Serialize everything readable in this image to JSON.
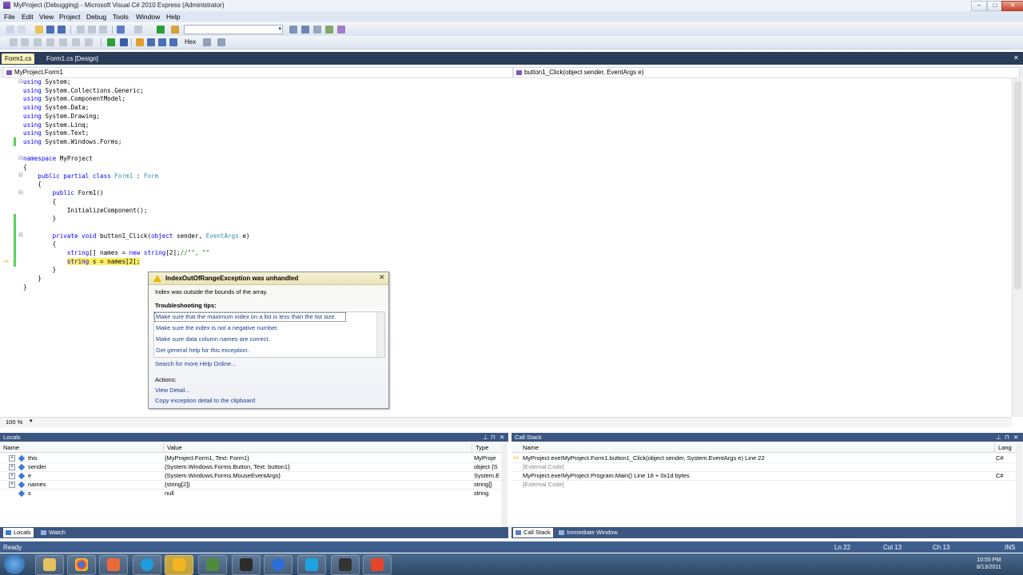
{
  "window": {
    "title": "MyProject (Debugging) - Microsoft Visual C# 2010 Express (Administrator)",
    "min": "–",
    "max": "□",
    "close": "✕"
  },
  "menu": [
    "File",
    "Edit",
    "View",
    "Project",
    "Debug",
    "Tools",
    "Window",
    "Help"
  ],
  "toolbar": {
    "hex_label": "Hex",
    "combo_value": ""
  },
  "doc_tabs": [
    "Form1.cs",
    "Form1.cs [Design]"
  ],
  "nav": {
    "class_combo": "MyProject.Form1",
    "member_combo": "button1_Click(object sender, EventArgs e)"
  },
  "code": [
    "using System;",
    "using System.Collections.Generic;",
    "using System.ComponentModel;",
    "using System.Data;",
    "using System.Drawing;",
    "using System.Linq;",
    "using System.Text;",
    "using System.Windows.Forms;",
    "",
    "namespace MyProject",
    "{",
    "    public partial class Form1 : Form",
    "    {",
    "        public Form1()",
    "        {",
    "            InitializeComponent();",
    "        }",
    "",
    "        private void button1_Click(object sender, EventArgs e)",
    "        {",
    "            string[] names = new string[2];//\"\", \"\"",
    "            string s = names[2];",
    "        }",
    "    }",
    "}"
  ],
  "zoom": "100 %",
  "exception": {
    "title": "IndexOutOfRangeException was unhandled",
    "message": "Index was outside the bounds of the array.",
    "tips_heading": "Troubleshooting tips:",
    "tips": [
      "Make sure that the maximum index on a list is less than the list size.",
      "Make sure the index is not a negative number.",
      "Make sure data column names are correct.",
      "Get general help for this exception."
    ],
    "search_link": "Search for more Help Online...",
    "actions_heading": "Actions:",
    "actions": [
      "View Detail...",
      "Copy exception detail to the clipboard"
    ],
    "close": "✕"
  },
  "locals": {
    "title": "Locals",
    "columns": [
      "Name",
      "Value",
      "Type"
    ],
    "rows": [
      {
        "name": "this",
        "value": "{MyProject.Form1, Text: Form1}",
        "type": "MyProje",
        "expandable": true
      },
      {
        "name": "sender",
        "value": "{System.Windows.Forms.Button, Text: button1}",
        "type": "object {S",
        "expandable": true
      },
      {
        "name": "e",
        "value": "{System.Windows.Forms.MouseEventArgs}",
        "type": "System.E",
        "expandable": true
      },
      {
        "name": "names",
        "value": "{string[2]}",
        "type": "string[]",
        "expandable": true
      },
      {
        "name": "s",
        "value": "null",
        "type": "string",
        "expandable": false
      }
    ],
    "tabs": [
      "Locals",
      "Watch"
    ]
  },
  "callstack": {
    "title": "Call Stack",
    "columns": [
      "Name",
      "Lang"
    ],
    "rows": [
      {
        "name": "MyProject.exe!MyProject.Form1.button1_Click(object sender, System.EventArgs e) Line 22",
        "lang": "C#",
        "current": true
      },
      {
        "name": "[External Code]",
        "lang": "",
        "current": false
      },
      {
        "name": "MyProject.exe!MyProject.Program.Main() Line 18 + 0x1d bytes",
        "lang": "C#",
        "current": false
      },
      {
        "name": "[External Code]",
        "lang": "",
        "current": false
      }
    ],
    "tabs": [
      "Call Stack",
      "Immediate Window"
    ]
  },
  "status": {
    "text": "Ready",
    "ln": "Ln 22",
    "col": "Col 13",
    "ch": "Ch 13",
    "mode": "INS"
  },
  "clock": {
    "time": "10:55 PM",
    "date": "8/13/2011"
  },
  "colors": {
    "accent": "#3b5680",
    "current_line": "#ffee62",
    "status_bar": "#3e5e8e"
  },
  "icons": [
    "vs-logo-icon",
    "start-orb-icon",
    "explorer-icon",
    "chrome-icon",
    "skype-icon",
    "visual-studio-icon",
    "warning-icon",
    "arrow-icon"
  ]
}
